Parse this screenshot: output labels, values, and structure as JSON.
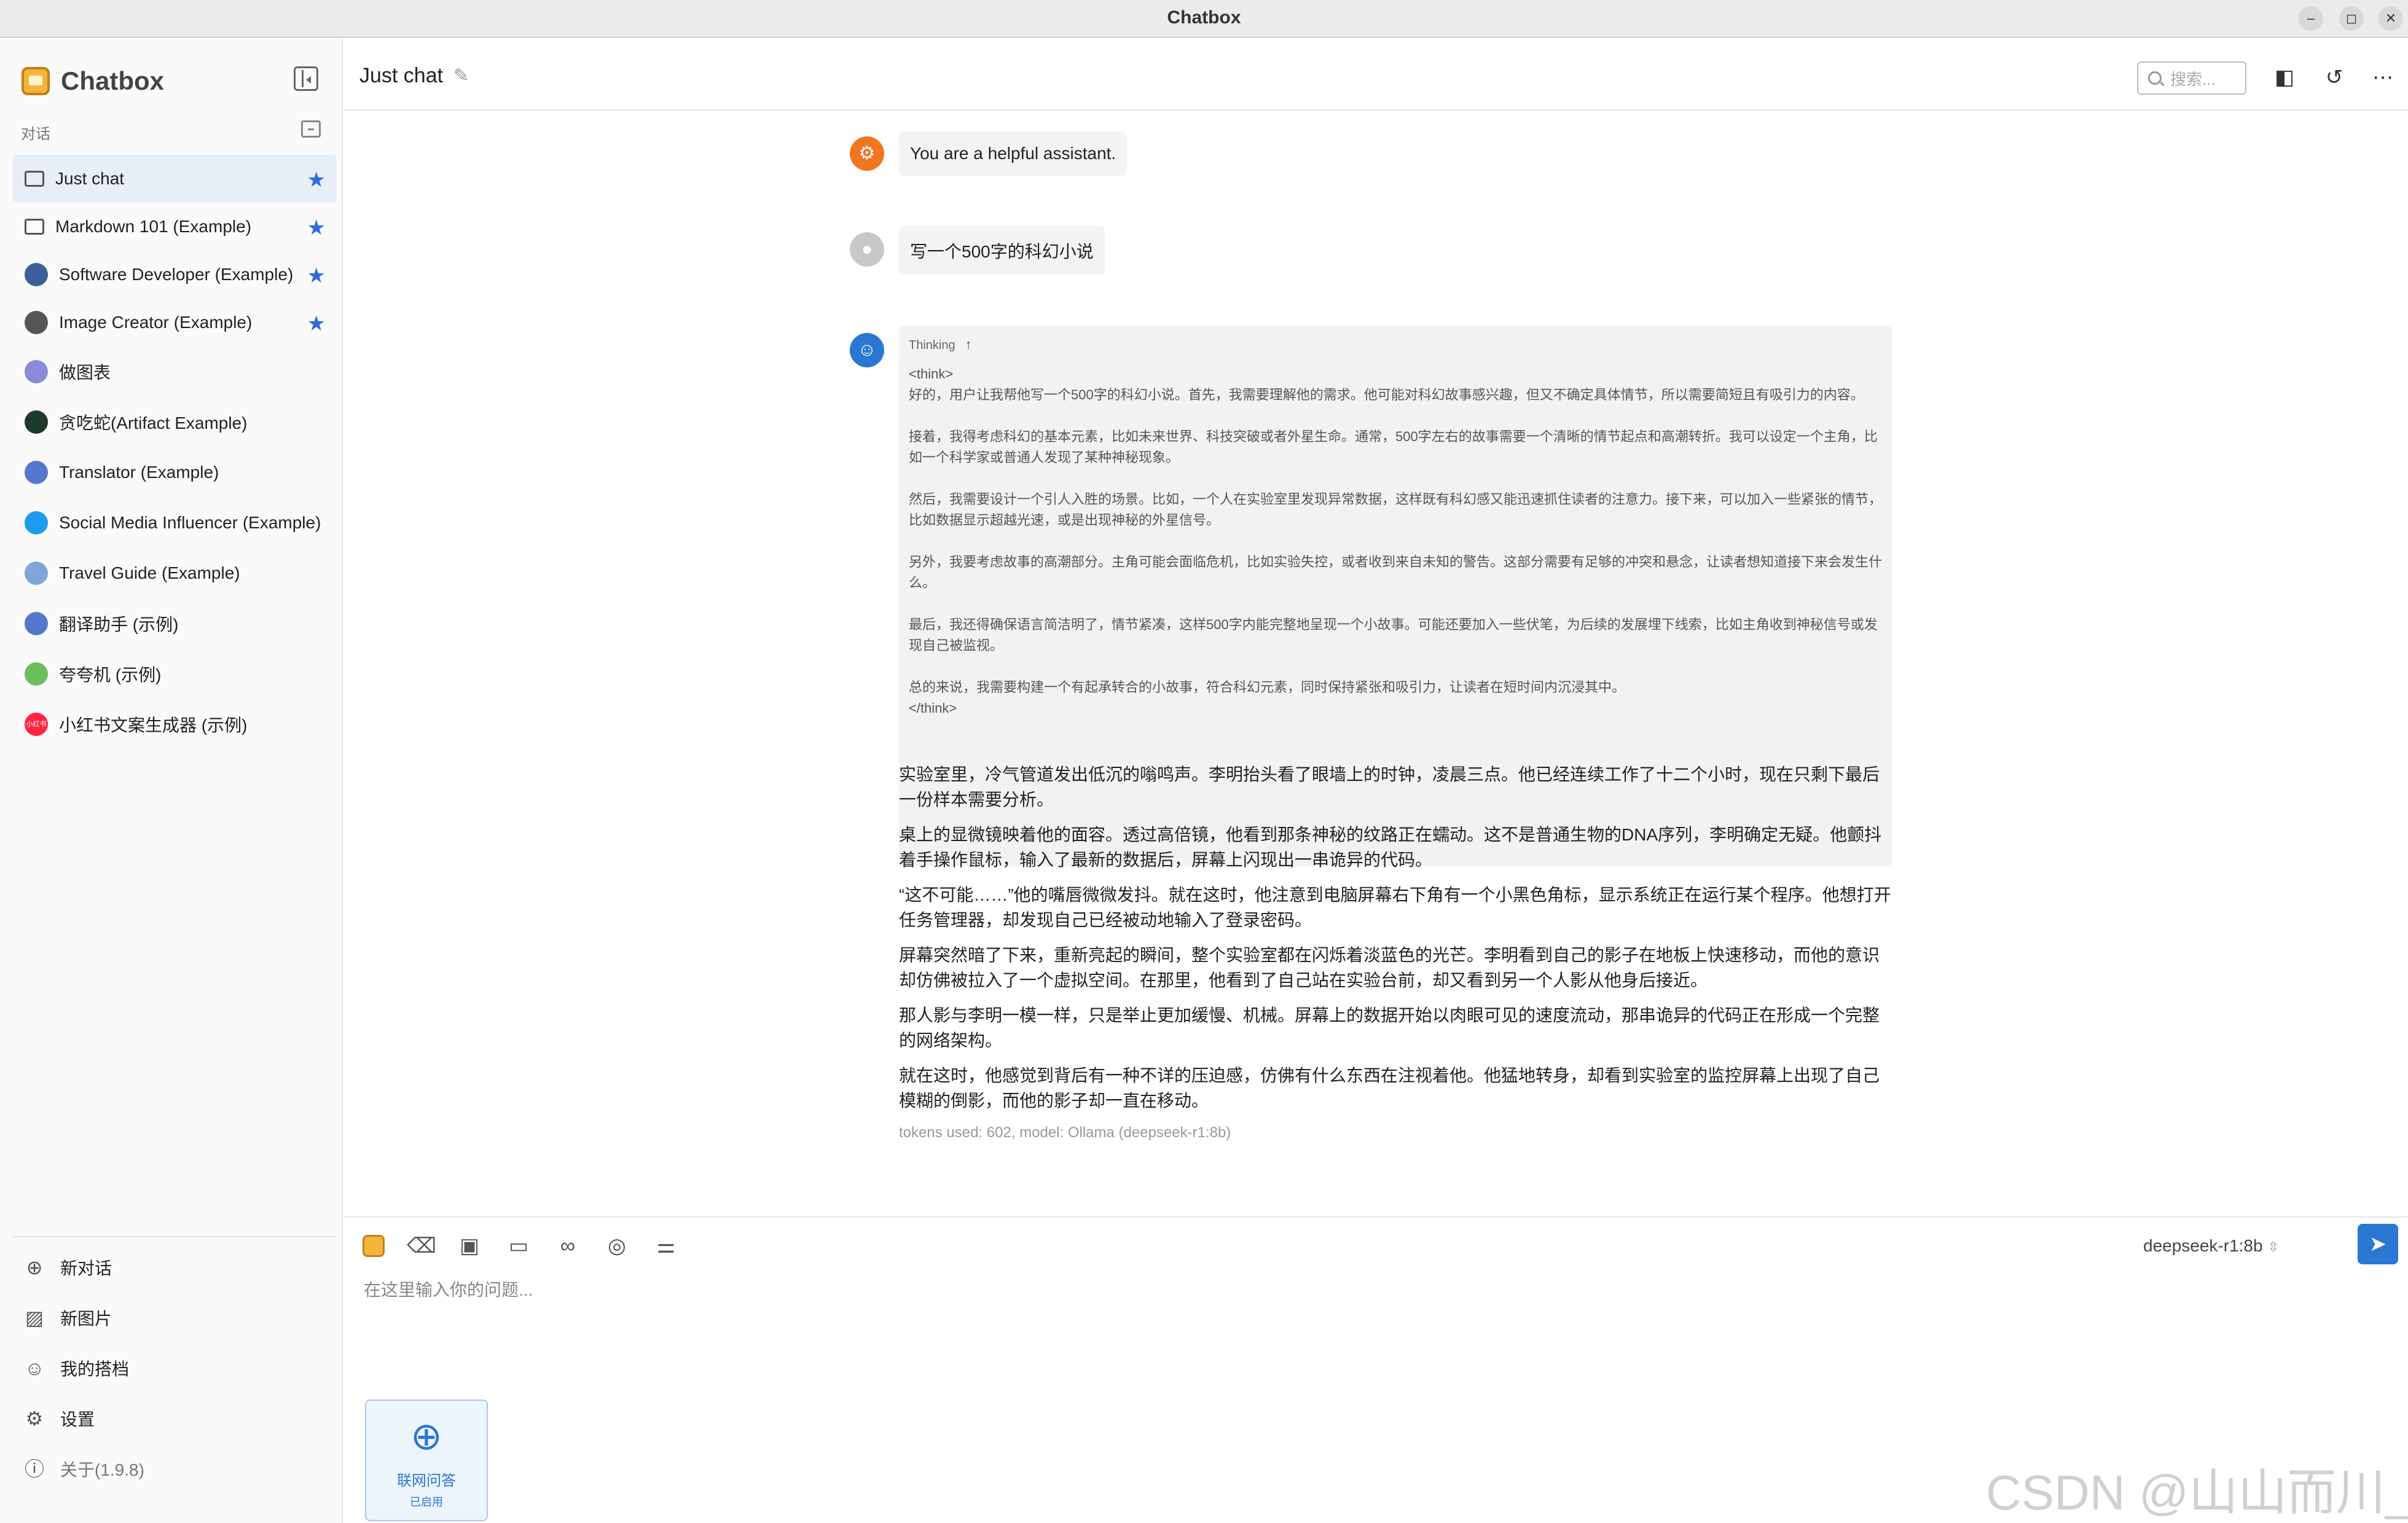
{
  "window": {
    "title": "Chatbox",
    "minimize": "–",
    "maximize": "◻",
    "close": "✕"
  },
  "sidebar": {
    "brand": "Chatbox",
    "section_label": "对话",
    "sessions": [
      {
        "label": "Just chat",
        "starred": "★",
        "icon": "chat-bubble-icon",
        "color": "#555555"
      },
      {
        "label": "Markdown 101 (Example)",
        "starred": "★",
        "icon": "chat-bubble-icon",
        "color": "#555555"
      },
      {
        "label": "Software Developer (Example)",
        "starred": "★",
        "icon": "developer-avatar-icon",
        "color": "#3b5f9a"
      },
      {
        "label": "Image Creator (Example)",
        "starred": "★",
        "icon": "image-icon",
        "color": "#555555"
      },
      {
        "label": "做图表",
        "icon": "chart-icon",
        "color": "#8a8ad8"
      },
      {
        "label": "贪吃蛇(Artifact Example)",
        "icon": "snake-game-icon",
        "color": "#1d3b2a"
      },
      {
        "label": "Translator (Example)",
        "icon": "translator-icon",
        "color": "#5577cc"
      },
      {
        "label": "Social Media Influencer (Example)",
        "icon": "twitter-icon",
        "color": "#1d9bf0"
      },
      {
        "label": "Travel Guide (Example)",
        "icon": "globe-icon",
        "color": "#7ea6d6"
      },
      {
        "label": "翻译助手 (示例)",
        "icon": "translator-icon",
        "color": "#5577cc"
      },
      {
        "label": "夸夸机 (示例)",
        "icon": "flower-icon",
        "color": "#6cbf5a"
      },
      {
        "label": "小红书文案生成器 (示例)",
        "icon": "xiaohongshu-icon",
        "color": "#ff2442",
        "badge": "小红书"
      }
    ],
    "bottom": {
      "new_chat": "新对话",
      "new_image": "新图片",
      "my_partners": "我的搭档",
      "settings": "设置",
      "about": "关于(1.9.8)"
    }
  },
  "header": {
    "title": "Just chat",
    "search_placeholder": "搜索..."
  },
  "messages": {
    "system": {
      "text": "You are a helpful assistant.",
      "avatar_color": "#f07722"
    },
    "user": {
      "text": "写一个500字的科幻小说",
      "avatar_color": "#c8c8c8"
    },
    "assistant": {
      "avatar_color": "#2a77d4",
      "thinking_label": "Thinking",
      "thinking_arrow": "↑",
      "think_open": "<think>",
      "think_paragraphs": [
        "好的，用户让我帮他写一个500字的科幻小说。首先，我需要理解他的需求。他可能对科幻故事感兴趣，但又不确定具体情节，所以需要简短且有吸引力的内容。",
        "接着，我得考虑科幻的基本元素，比如未来世界、科技突破或者外星生命。通常，500字左右的故事需要一个清晰的情节起点和高潮转折。我可以设定一个主角，比如一个科学家或普通人发现了某种神秘现象。",
        "然后，我需要设计一个引人入胜的场景。比如，一个人在实验室里发现异常数据，这样既有科幻感又能迅速抓住读者的注意力。接下来，可以加入一些紧张的情节，比如数据显示超越光速，或是出现神秘的外星信号。",
        "另外，我要考虑故事的高潮部分。主角可能会面临危机，比如实验失控，或者收到来自未知的警告。这部分需要有足够的冲突和悬念，让读者想知道接下来会发生什么。",
        "最后，我还得确保语言简洁明了，情节紧凑，这样500字内能完整地呈现一个小故事。可能还要加入一些伏笔，为后续的发展埋下线索，比如主角收到神秘信号或发现自己被监视。",
        "总的来说，我需要构建一个有起承转合的小故事，符合科幻元素，同时保持紧张和吸引力，让读者在短时间内沉浸其中。"
      ],
      "think_close": "</think>",
      "answer_paragraphs": [
        "实验室里，冷气管道发出低沉的嗡鸣声。李明抬头看了眼墙上的时钟，凌晨三点。他已经连续工作了十二个小时，现在只剩下最后一份样本需要分析。",
        "桌上的显微镜映着他的面容。透过高倍镜，他看到那条神秘的纹路正在蠕动。这不是普通生物的DNA序列，李明确定无疑。他颤抖着手操作鼠标，输入了最新的数据后，屏幕上闪现出一串诡异的代码。",
        "“这不可能……”他的嘴唇微微发抖。就在这时，他注意到电脑屏幕右下角有一个小黑色角标，显示系统正在运行某个程序。他想打开任务管理器，却发现自己已经被动地输入了登录密码。",
        "屏幕突然暗了下来，重新亮起的瞬间，整个实验室都在闪烁着淡蓝色的光芒。李明看到自己的影子在地板上快速移动，而他的意识却仿佛被拉入了一个虚拟空间。在那里，他看到了自己站在实验台前，却又看到另一个人影从他身后接近。",
        "那人影与李明一模一样，只是举止更加缓慢、机械。屏幕上的数据开始以肉眼可见的速度流动，那串诡异的代码正在形成一个完整的网络架构。",
        "就在这时，他感觉到背后有一种不详的压迫感，仿佛有什么东西在注视着他。他猛地转身，却看到实验室的监控屏幕上出现了自己模糊的倒影，而他的影子却一直在移动。"
      ],
      "meta": "tokens used: 602, model: Ollama (deepseek-r1:8b)"
    }
  },
  "input": {
    "placeholder": "在这里输入你的问题...",
    "model": "deepseek-r1:8b",
    "web_card": {
      "label": "联网问答",
      "status": "已启用"
    }
  },
  "watermark": "CSDN @山山而川_R",
  "colors": {
    "accent": "#2a77d4",
    "star": "#2a6fdb",
    "active_bg": "#e8eef8"
  }
}
